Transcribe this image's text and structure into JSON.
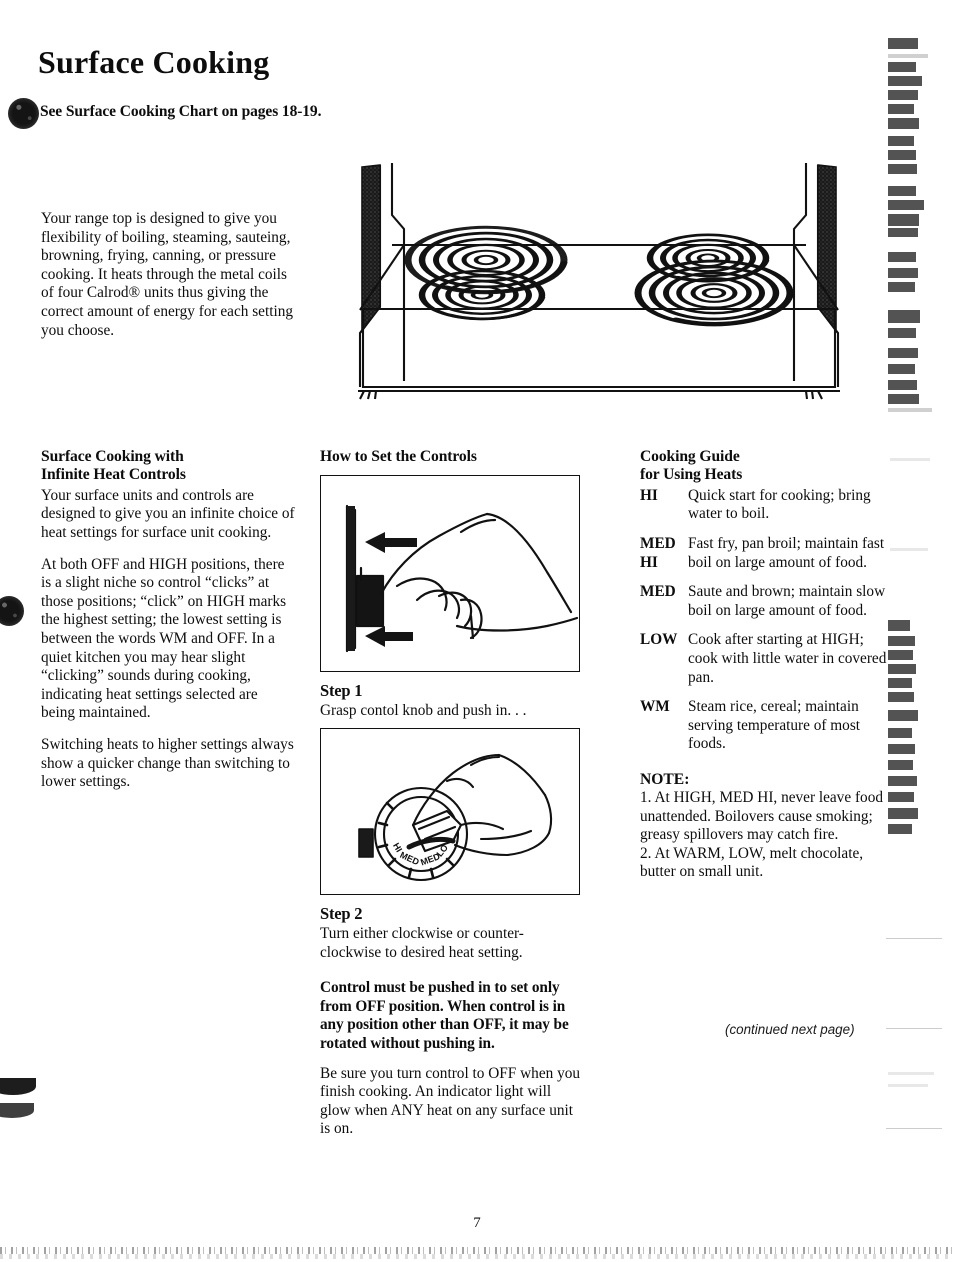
{
  "document": {
    "title": "Surface Cooking",
    "chart_reference": "See Surface Cooking Chart on pages 18-19.",
    "page_number": "7",
    "continued_note": "(continued next page)"
  },
  "intro": {
    "text": "Your range top is designed to give you flexibility of boiling, steaming, sauteing, browning, frying, canning, or pressure cooking. It heats through the metal coils of four Calrod® units thus giving the correct amount of energy for each setting you choose."
  },
  "figures": {
    "range_top": "range-top-cooktop-illustration",
    "step1_figure": "hand-pushing-knob-illustration",
    "step2_figure": "hand-turning-knob-dial-illustration"
  },
  "left_column": {
    "heading_line1": "Surface Cooking with",
    "heading_line2": "Infinite Heat Controls",
    "paragraphs": [
      "Your surface units and controls are designed to give you an infinite choice of heat settings for surface unit cooking.",
      "At both OFF and HIGH positions, there is a slight niche so control “clicks” at those positions; “click” on HIGH marks the highest setting; the lowest setting is between the words WM and OFF. In a quiet kitchen you may hear slight “clicking” sounds during cooking, indicating heat settings selected are being maintained.",
      "Switching heats to higher settings always show a quicker change than switching to lower settings."
    ]
  },
  "middle_column": {
    "heading": "How to Set the Controls",
    "step1_label": "Step 1",
    "step1_text": "Grasp contol knob and push in. . .",
    "step2_label": "Step 2",
    "step2_text": "Turn either clockwise or counter-clockwise to desired heat setting.",
    "bold_warning": "Control must be pushed in to set only from OFF position. When control is in any position other than OFF, it may be rotated without pushing in.",
    "closing_text": "Be sure you turn control to OFF when you finish cooking. An indicator light will glow when ANY heat on any surface unit is on."
  },
  "right_column": {
    "heading_line1": "Cooking Guide",
    "heading_line2": "for Using Heats",
    "heat_settings": [
      {
        "key": "HI",
        "description": "Quick start for cooking; bring water to boil."
      },
      {
        "key": "MED\nHI",
        "description": "Fast fry, pan broil; maintain fast boil on large amount of food."
      },
      {
        "key": "MED",
        "description": "Saute and brown; maintain slow boil on large amount of food."
      },
      {
        "key": "LOW",
        "description": "Cook after starting at HIGH; cook with little water in covered pan."
      },
      {
        "key": "WM",
        "description": "Steam rice, cereal; maintain serving temperature of most foods."
      }
    ],
    "note_heading": "NOTE:",
    "notes": [
      "1. At HIGH, MED HI, never leave food unattended. Boilovers cause smoking; greasy spillovers may catch fire.",
      "2. At WARM, LOW, melt chocolate, butter on small unit."
    ]
  },
  "knob_dial_labels": [
    "HI",
    "MED HI",
    "MED",
    "LO"
  ]
}
